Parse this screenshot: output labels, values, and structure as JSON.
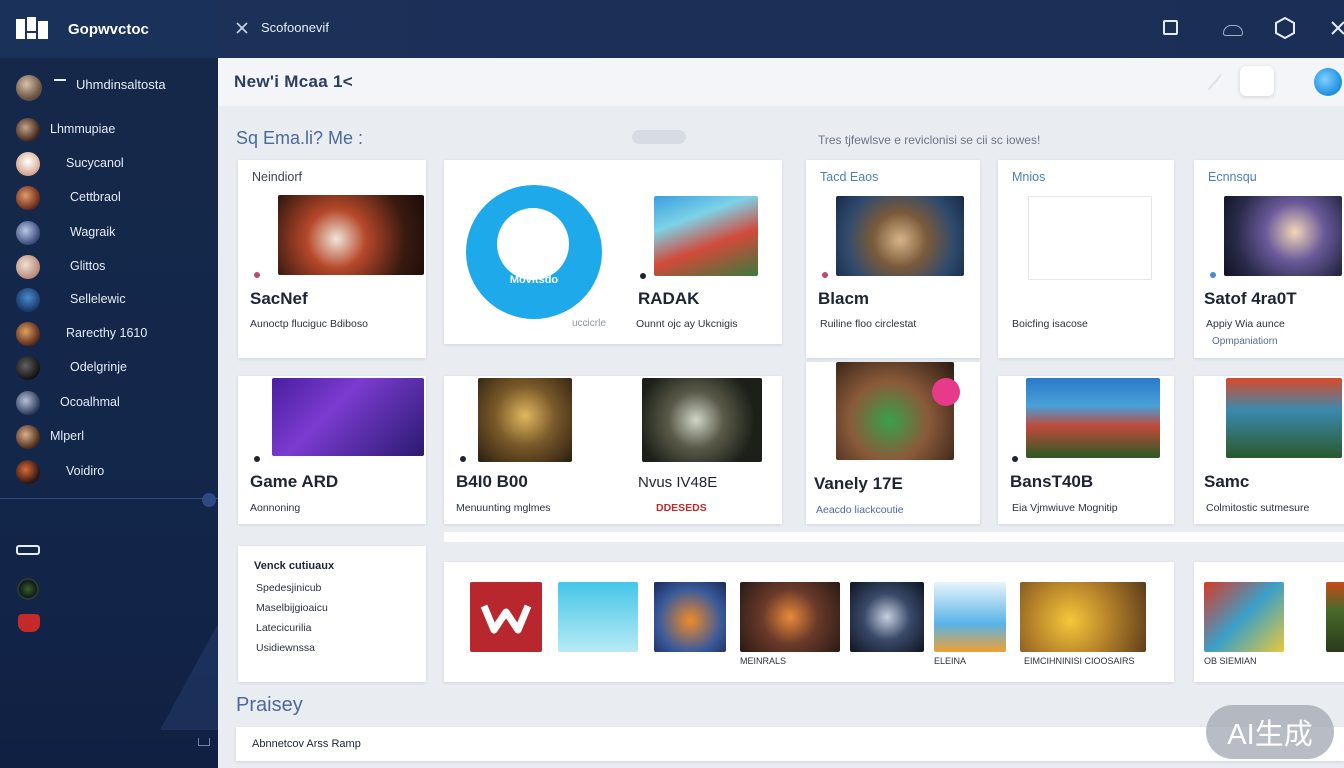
{
  "app": {
    "name": "Gopwvctoc"
  },
  "topbar": {
    "title": "Scofoonevif"
  },
  "user": {
    "label": "Uhmdinsaltosta"
  },
  "sidebar": {
    "items": [
      {
        "label": "Lhmmupiae"
      },
      {
        "label": "Sucycanol"
      },
      {
        "label": "Cettbraol"
      },
      {
        "label": "Wagraik"
      },
      {
        "label": "Glittos"
      },
      {
        "label": "Sellelewic"
      },
      {
        "label": "Rarecthy 1610"
      },
      {
        "label": "Odelgrinje"
      },
      {
        "label": "Ocoalhmal"
      },
      {
        "label": "Mlperl"
      },
      {
        "label": "Voidiro"
      }
    ]
  },
  "subheader": {
    "title": "New'i Mcaa 1<"
  },
  "section1": {
    "title": "Sq Ema.li? Me :",
    "note": "Tres tjfewlsve e reviclonisi se cii sc iowes!"
  },
  "section2": {
    "title": "Praisey"
  },
  "cards_row1": [
    {
      "head": "Neindiorf",
      "title": "SacNef",
      "sub": "Aunoctp fluciguc  Bdiboso"
    },
    {
      "logo_text": "Movitsdo",
      "small": "uccicrle",
      "title": "RADAK",
      "sub": "Ounnt ojc ay Ukcnigis"
    },
    {
      "head": "Tacd Eaos",
      "title": "Blacm",
      "sub": "Ruiline floo  circlestat"
    },
    {
      "head": "Mnios",
      "title": "",
      "sub": "Boicfing  isacose"
    },
    {
      "head": "Ecnnsqu",
      "title": "Satof 4ra0T",
      "sub": "Appiy Wia aunce",
      "sub2": "Opmpaniatiorn"
    }
  ],
  "cards_row2": [
    {
      "title": "Game ARD",
      "sub": "Aonnoning"
    },
    {
      "title": "B4I0 B00",
      "sub": "Menuunting  mglmes"
    },
    {
      "title": "Nvus IV48E",
      "sub": "DDESEDS"
    },
    {
      "title": "Vanely 17E",
      "sub": "Aeacdo  liackcoutie"
    },
    {
      "title": "BansT40B",
      "sub": "Eia Vjmwiuve  Mognitip"
    },
    {
      "title": "Samc",
      "sub": "Colmitostic  sutmesure"
    }
  ],
  "list_card": {
    "title": "Venck cutiuaux",
    "items": [
      "Spedesjinicub",
      "Maselbijgioaicu",
      "Latecicurilia",
      "Usidiewnssa"
    ]
  },
  "strip": {
    "captions": [
      "MEINRALS",
      "ELEINA",
      "EIMCIHNINISI CIOOSAIRS",
      "OB SIEMIAN"
    ]
  },
  "bottom_bar": {
    "label": "Abnnetcov Arss Ramp"
  },
  "watermark": {
    "text": "AI生成"
  }
}
